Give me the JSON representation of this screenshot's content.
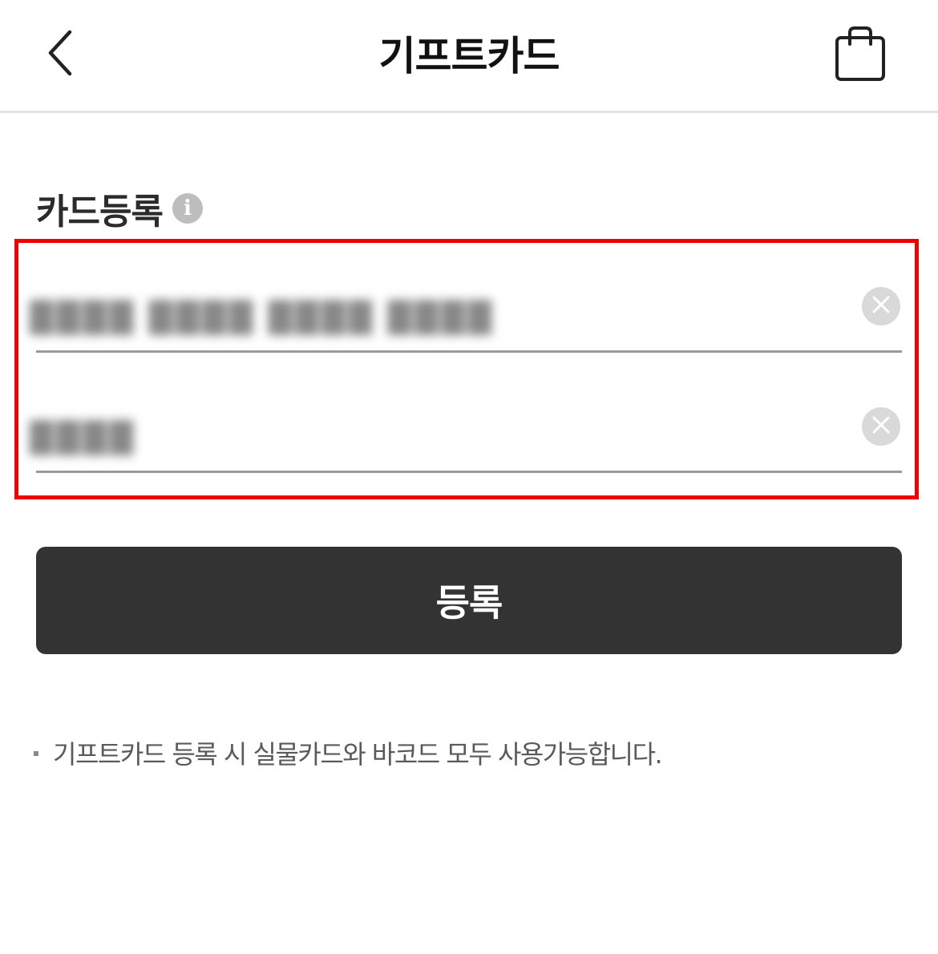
{
  "header": {
    "title": "기프트카드",
    "back_icon": "chevron-left-icon",
    "cart_icon": "shopping-bag-icon"
  },
  "section": {
    "title": "카드등록",
    "info_icon": "info-icon"
  },
  "form": {
    "card_number_value": "████ ████ ████ ████",
    "pin_value": "████",
    "clear_icon": "close-circle-icon"
  },
  "submit": {
    "label": "등록"
  },
  "notice": {
    "text": "기프트카드 등록 시 실물카드와 바코드 모두 사용가능합니다."
  },
  "colors": {
    "highlight": "#ee0000",
    "button_bg": "#333333",
    "underline": "#9a9a9a"
  }
}
